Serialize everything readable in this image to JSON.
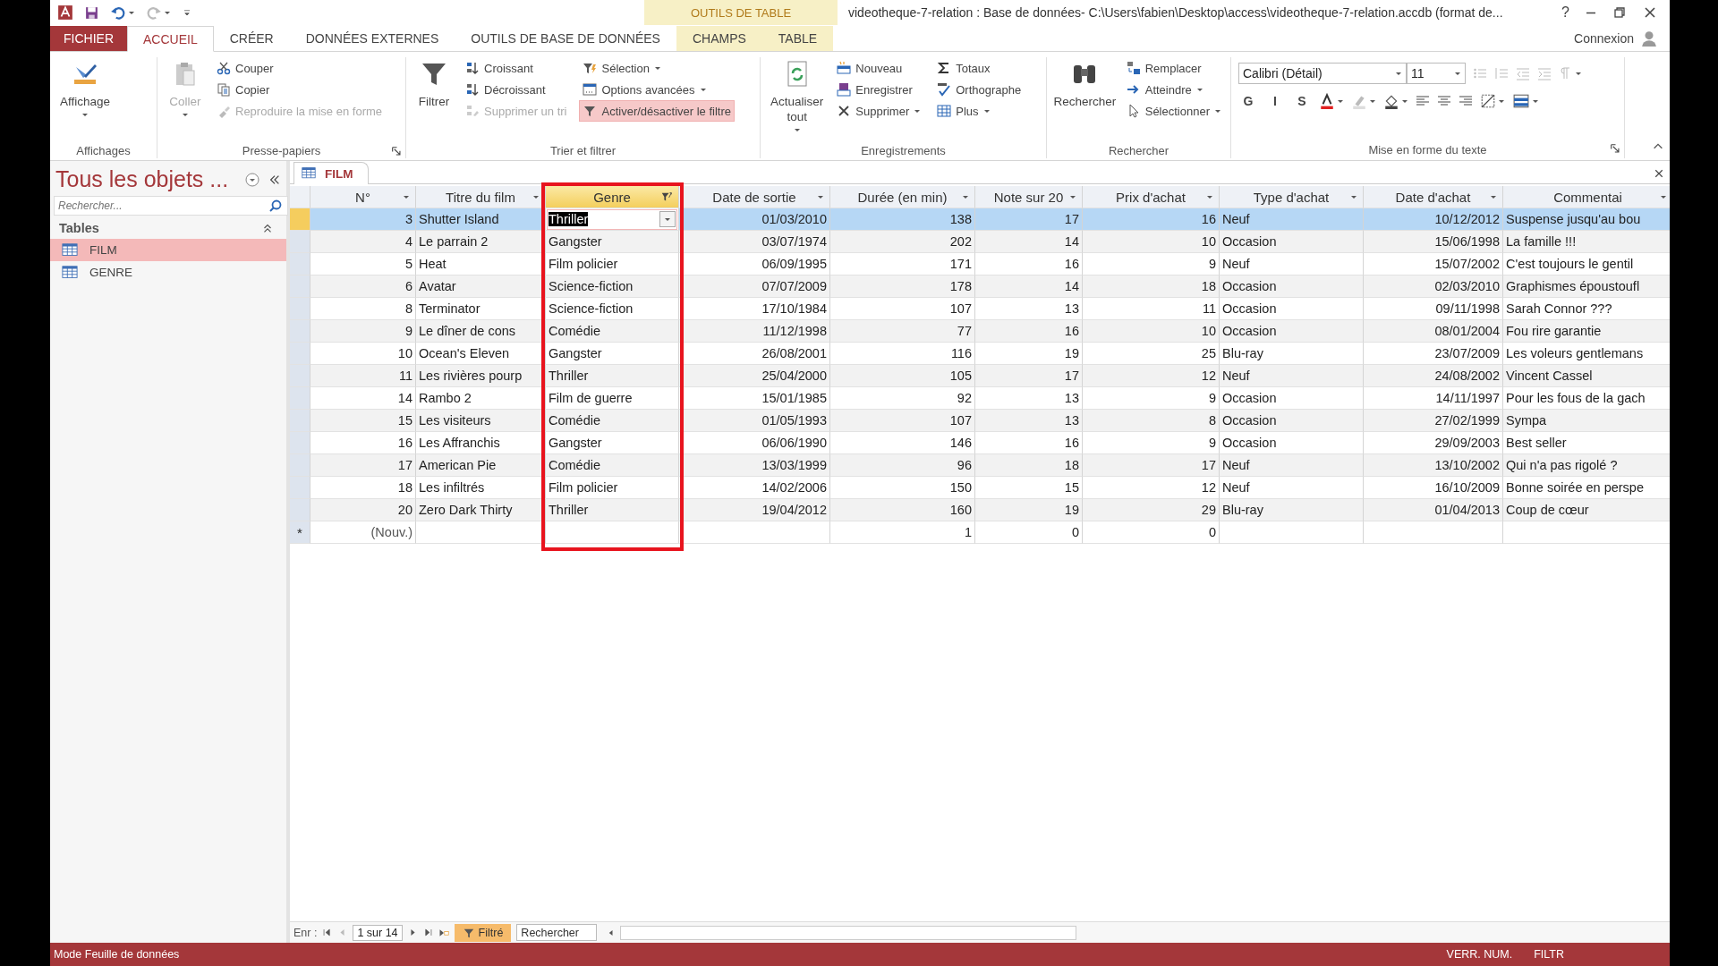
{
  "title_bar": {
    "title": "videotheque-7-relation : Base de données- C:\\Users\\fabien\\Desktop\\access\\videotheque-7-relation.accdb (format de...",
    "help": "?"
  },
  "context_label": "OUTILS DE TABLE",
  "ribbon_tabs": [
    {
      "label": "FICHIER",
      "kind": "file",
      "selected": false
    },
    {
      "label": "ACCUEIL",
      "kind": "tab",
      "selected": true
    },
    {
      "label": "CRÉER",
      "kind": "tab",
      "selected": false
    },
    {
      "label": "DONNÉES EXTERNES",
      "kind": "tab",
      "selected": false
    },
    {
      "label": "OUTILS DE BASE DE DONNÉES",
      "kind": "tab",
      "selected": false
    },
    {
      "label": "CHAMPS",
      "kind": "context",
      "selected": false
    },
    {
      "label": "TABLE",
      "kind": "context",
      "selected": false
    }
  ],
  "account": "Connexion",
  "ribbon_groups": [
    {
      "label": "Affichages",
      "kind": "commands",
      "launcher": false,
      "items": [
        {
          "label": "Affichage",
          "kind": "large",
          "dropdown": true,
          "disabled": false,
          "on": false
        }
      ]
    },
    {
      "label": "Presse-papiers",
      "kind": "commands",
      "launcher": true,
      "items": [
        {
          "label": "Coller",
          "kind": "large",
          "dropdown": true,
          "disabled": true,
          "on": false
        },
        {
          "label": "Couper",
          "kind": "small",
          "dropdown": false,
          "disabled": false,
          "on": false
        },
        {
          "label": "Copier",
          "kind": "small",
          "dropdown": false,
          "disabled": false,
          "on": false
        },
        {
          "label": "Reproduire la mise en forme",
          "kind": "small",
          "dropdown": false,
          "disabled": true,
          "on": false
        }
      ]
    },
    {
      "label": "Trier et filtrer",
      "kind": "commands",
      "launcher": false,
      "items": [
        {
          "label": "Filtrer",
          "kind": "large",
          "dropdown": false,
          "disabled": false,
          "on": false
        },
        {
          "label": "Croissant",
          "kind": "small",
          "dropdown": false,
          "disabled": false,
          "on": false
        },
        {
          "label": "Décroissant",
          "kind": "small",
          "dropdown": false,
          "disabled": false,
          "on": false
        },
        {
          "label": "Supprimer un tri",
          "kind": "small",
          "dropdown": false,
          "disabled": true,
          "on": false
        },
        {
          "label": "Sélection",
          "kind": "small",
          "dropdown": true,
          "disabled": false,
          "on": false
        },
        {
          "label": "Options avancées",
          "kind": "small",
          "dropdown": true,
          "disabled": false,
          "on": false
        },
        {
          "label": "Activer/désactiver le filtre",
          "kind": "small",
          "dropdown": false,
          "disabled": false,
          "on": true
        }
      ]
    },
    {
      "label": "Enregistrements",
      "kind": "commands",
      "launcher": false,
      "items": [
        {
          "label": "Actualiser tout",
          "kind": "large",
          "dropdown": true,
          "disabled": false,
          "on": false
        },
        {
          "label": "Nouveau",
          "kind": "small",
          "dropdown": false,
          "disabled": false,
          "on": false
        },
        {
          "label": "Enregistrer",
          "kind": "small",
          "dropdown": false,
          "disabled": false,
          "on": false
        },
        {
          "label": "Supprimer",
          "kind": "small",
          "dropdown": true,
          "disabled": false,
          "on": false
        },
        {
          "label": "Totaux",
          "kind": "small",
          "dropdown": false,
          "disabled": false,
          "on": false
        },
        {
          "label": "Orthographe",
          "kind": "small",
          "dropdown": false,
          "disabled": false,
          "on": false
        },
        {
          "label": "Plus",
          "kind": "small",
          "dropdown": true,
          "disabled": false,
          "on": false
        }
      ]
    },
    {
      "label": "Rechercher",
      "kind": "commands",
      "launcher": false,
      "items": [
        {
          "label": "Rechercher",
          "kind": "large",
          "dropdown": false,
          "disabled": false,
          "on": false
        },
        {
          "label": "Remplacer",
          "kind": "small",
          "dropdown": false,
          "disabled": false,
          "on": false
        },
        {
          "label": "Atteindre",
          "kind": "small",
          "dropdown": true,
          "disabled": false,
          "on": false
        },
        {
          "label": "Sélectionner",
          "kind": "small",
          "dropdown": true,
          "disabled": false,
          "on": false
        }
      ]
    },
    {
      "label": "Mise en forme du texte",
      "kind": "font",
      "launcher": true,
      "font": "Calibri (Détail)",
      "size": "11",
      "styles": [
        "G",
        "I",
        "S"
      ]
    }
  ],
  "nav_pane": {
    "title": "Tous les objets ...",
    "search_placeholder": "Rechercher...",
    "sections": [
      {
        "label": "Tables",
        "expanded": true,
        "items": [
          {
            "label": "FILM",
            "selected": true
          },
          {
            "label": "GENRE",
            "selected": false
          }
        ]
      }
    ]
  },
  "datasheet": {
    "tab": "FILM",
    "columns": [
      {
        "label": "N°",
        "kind": "number",
        "filtered": false,
        "highlighted": false
      },
      {
        "label": "Titre du film",
        "kind": "text",
        "filtered": false,
        "highlighted": false
      },
      {
        "label": "Genre",
        "kind": "lookup",
        "filtered": true,
        "highlighted": true
      },
      {
        "label": "Date de sortie",
        "kind": "number",
        "filtered": false,
        "highlighted": false
      },
      {
        "label": "Durée (en min)",
        "kind": "number",
        "filtered": false,
        "highlighted": false
      },
      {
        "label": "Note sur 20",
        "kind": "number",
        "filtered": false,
        "highlighted": false
      },
      {
        "label": "Prix d'achat",
        "kind": "number",
        "filtered": false,
        "highlighted": false
      },
      {
        "label": "Type d'achat",
        "kind": "text",
        "filtered": false,
        "highlighted": false
      },
      {
        "label": "Date d'achat",
        "kind": "number",
        "filtered": false,
        "highlighted": false
      },
      {
        "label": "Commentai",
        "kind": "text",
        "filtered": false,
        "highlighted": false
      }
    ],
    "rows": [
      {
        "selected": true,
        "editing": true,
        "cells": [
          "3",
          "Shutter Island",
          "Thriller",
          "01/03/2010",
          "138",
          "17",
          "16",
          "Neuf",
          "10/12/2012",
          "Suspense jusqu'au bou"
        ]
      },
      {
        "selected": false,
        "editing": false,
        "cells": [
          "4",
          "Le parrain 2",
          "Gangster",
          "03/07/1974",
          "202",
          "14",
          "10",
          "Occasion",
          "15/06/1998",
          "La famille !!!"
        ]
      },
      {
        "selected": false,
        "editing": false,
        "cells": [
          "5",
          "Heat",
          "Film policier",
          "06/09/1995",
          "171",
          "16",
          "9",
          "Neuf",
          "15/07/2002",
          "C'est toujours le gentil"
        ]
      },
      {
        "selected": false,
        "editing": false,
        "cells": [
          "6",
          "Avatar",
          "Science-fiction",
          "07/07/2009",
          "178",
          "14",
          "18",
          "Occasion",
          "02/03/2010",
          "Graphismes époustoufl"
        ]
      },
      {
        "selected": false,
        "editing": false,
        "cells": [
          "8",
          "Terminator",
          "Science-fiction",
          "17/10/1984",
          "107",
          "13",
          "11",
          "Occasion",
          "09/11/1998",
          "Sarah Connor ???"
        ]
      },
      {
        "selected": false,
        "editing": false,
        "cells": [
          "9",
          "Le dîner de cons",
          "Comédie",
          "11/12/1998",
          "77",
          "16",
          "10",
          "Occasion",
          "08/01/2004",
          "Fou rire garantie"
        ]
      },
      {
        "selected": false,
        "editing": false,
        "cells": [
          "10",
          "Ocean's Eleven",
          "Gangster",
          "26/08/2001",
          "116",
          "19",
          "25",
          "Blu-ray",
          "23/07/2009",
          "Les voleurs gentlemans"
        ]
      },
      {
        "selected": false,
        "editing": false,
        "cells": [
          "11",
          "Les rivières pourp",
          "Thriller",
          "25/04/2000",
          "105",
          "17",
          "12",
          "Neuf",
          "24/08/2002",
          "Vincent Cassel"
        ]
      },
      {
        "selected": false,
        "editing": false,
        "cells": [
          "14",
          "Rambo 2",
          "Film de guerre",
          "15/01/1985",
          "92",
          "13",
          "9",
          "Occasion",
          "14/11/1997",
          "Pour les fous de la gach"
        ]
      },
      {
        "selected": false,
        "editing": false,
        "cells": [
          "15",
          "Les visiteurs",
          "Comédie",
          "01/05/1993",
          "107",
          "13",
          "8",
          "Occasion",
          "27/02/1999",
          "Sympa"
        ]
      },
      {
        "selected": false,
        "editing": false,
        "cells": [
          "16",
          "Les Affranchis",
          "Gangster",
          "06/06/1990",
          "146",
          "16",
          "9",
          "Occasion",
          "29/09/2003",
          "Best seller"
        ]
      },
      {
        "selected": false,
        "editing": false,
        "cells": [
          "17",
          "American Pie",
          "Comédie",
          "13/03/1999",
          "96",
          "18",
          "17",
          "Neuf",
          "13/10/2002",
          "Qui n'a pas rigolé ?"
        ]
      },
      {
        "selected": false,
        "editing": false,
        "cells": [
          "18",
          "Les infiltrés",
          "Film policier",
          "14/02/2006",
          "150",
          "15",
          "12",
          "Neuf",
          "16/10/2009",
          "Bonne soirée en perspe"
        ]
      },
      {
        "selected": false,
        "editing": false,
        "cells": [
          "20",
          "Zero Dark Thirty",
          "Thriller",
          "19/04/2012",
          "160",
          "19",
          "29",
          "Blu-ray",
          "01/04/2013",
          "Coup de cœur"
        ]
      }
    ],
    "new_row": {
      "marker": "*",
      "cells": [
        "(Nouv.)",
        "",
        "",
        "",
        "1",
        "0",
        "0",
        "",
        "",
        ""
      ]
    },
    "record_nav": {
      "label": "Enr :",
      "position": "1 sur 14",
      "filter": {
        "label": "Filtré",
        "on": true
      },
      "search_placeholder": "Rechercher"
    }
  },
  "status_bar": {
    "mode": "Mode Feuille de données",
    "indicators": [
      "VERR. NUM.",
      "FILTR"
    ]
  }
}
